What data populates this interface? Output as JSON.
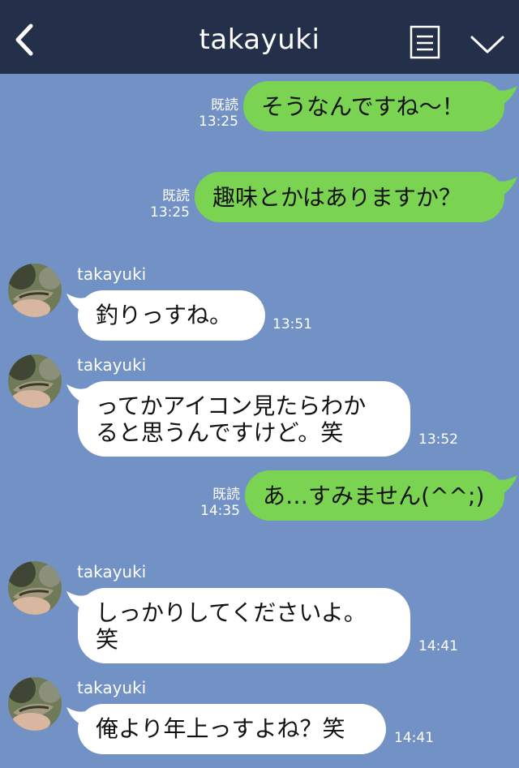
{
  "header": {
    "title": "takayuki"
  },
  "read_label": "既読",
  "messages": [
    {
      "dir": "out",
      "text": "そうなんですね〜！",
      "time": "13:25"
    },
    {
      "dir": "out",
      "text": "趣味とかはありますか？",
      "time": "13:25"
    },
    {
      "dir": "in",
      "sender": "takayuki",
      "text": "釣りっすね。",
      "time": "13:51"
    },
    {
      "dir": "in",
      "sender": "takayuki",
      "line1": "ってかアイコン見たらわか",
      "line2": "ると思うんですけど。笑",
      "time": "13:52"
    },
    {
      "dir": "out",
      "text": "あ…すみません(^^;)",
      "time": "14:35"
    },
    {
      "dir": "in",
      "sender": "takayuki",
      "line1": "しっかりしてくださいよ。",
      "line2": "笑",
      "time": "14:41"
    },
    {
      "dir": "in",
      "sender": "takayuki",
      "text": "俺より年上っすよね？笑",
      "time": "14:41"
    }
  ],
  "colors": {
    "background": "#7291c4",
    "header": "#243049",
    "outgoing_bubble": "#7ad452",
    "incoming_bubble": "#ffffff"
  },
  "icons": {
    "back": "chevron-left-icon",
    "note": "note-icon",
    "menu": "chevron-down-icon",
    "avatar": "fish-avatar"
  }
}
